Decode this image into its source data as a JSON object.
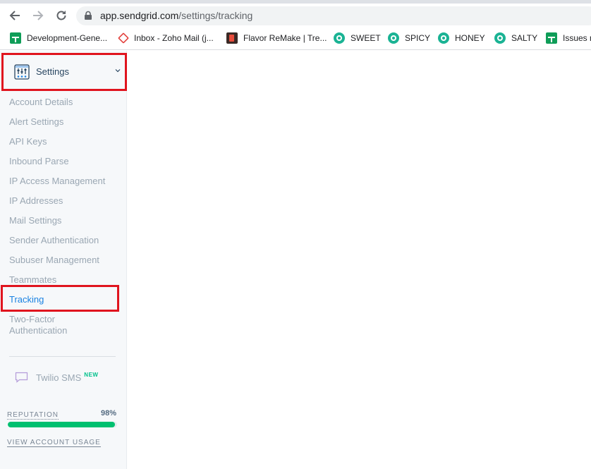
{
  "browser": {
    "url_host": "app.sendgrid.com",
    "url_path": "/settings/tracking",
    "bookmarks": [
      {
        "label": "Development-Gene...",
        "icon": "google-sheets-icon"
      },
      {
        "label": "Inbox - Zoho Mail (j...",
        "icon": "zoho-mail-icon"
      },
      {
        "label": "Flavor ReMake | Tre...",
        "icon": "flavor-remake-icon"
      },
      {
        "label": "SWEET",
        "icon": "teal-circle-icon"
      },
      {
        "label": "SPICY",
        "icon": "teal-circle-icon"
      },
      {
        "label": "HONEY",
        "icon": "teal-circle-icon"
      },
      {
        "label": "SALTY",
        "icon": "teal-circle-icon"
      },
      {
        "label": "Issues n",
        "icon": "google-sheets-icon"
      }
    ]
  },
  "sidebar": {
    "title": "Settings",
    "items": [
      {
        "label": "Account Details"
      },
      {
        "label": "Alert Settings"
      },
      {
        "label": "API Keys"
      },
      {
        "label": "Inbound Parse"
      },
      {
        "label": "IP Access Management"
      },
      {
        "label": "IP Addresses"
      },
      {
        "label": "Mail Settings"
      },
      {
        "label": "Sender Authentication"
      },
      {
        "label": "Subuser Management"
      },
      {
        "label": "Teammates"
      },
      {
        "label": "Tracking",
        "active": true
      },
      {
        "label": "Two-Factor",
        "label2": "Authentication"
      }
    ],
    "twilio": {
      "label": "Twilio SMS",
      "badge": "NEW"
    },
    "reputation": {
      "label": "REPUTATION",
      "value_text": "98%",
      "value": 0.98
    },
    "usage_link": "VIEW ACCOUNT USAGE"
  },
  "colors": {
    "accent": "#1a82e2",
    "highlight_box": "#e0141e",
    "reputation_bar": "#00c070"
  }
}
